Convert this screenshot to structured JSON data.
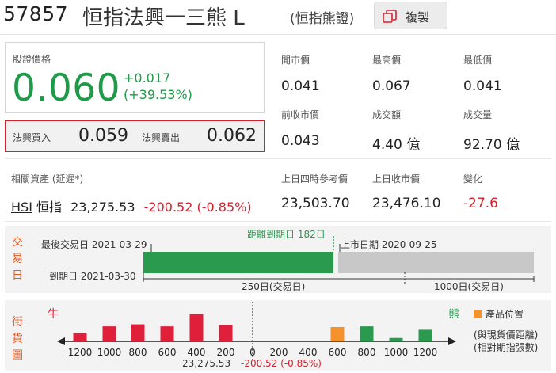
{
  "header": {
    "code": "57857",
    "name": "恒指法興一三熊 L",
    "underlying_tag": "(恒指熊證)",
    "copy_label": "複製"
  },
  "quote": {
    "price_label": "股證價格",
    "price": "0.060",
    "change": "+0.017",
    "change_pct": "(+39.53%)",
    "bid_label": "法興買入",
    "bid": "0.059",
    "ask_label": "法興賣出",
    "ask": "0.062"
  },
  "stats": {
    "open_label": "開市價",
    "open": "0.041",
    "high_label": "最高價",
    "high": "0.067",
    "low_label": "最低價",
    "low": "0.041",
    "prev_close_label": "前收市價",
    "prev_close": "0.043",
    "turnover_label": "成交額",
    "turnover": "4.40 億",
    "volume_label": "成交量",
    "volume": "92.70 億"
  },
  "related": {
    "label": "相關資產 (延遲*)",
    "asset_code": "HSI",
    "asset_name": "恒指",
    "asset_price": "23,275.53",
    "asset_change": "-200.52 (-0.85%)",
    "ref_label": "上日四時參考價",
    "ref_value": "23,503.70",
    "prev_close_label": "上日收市價",
    "prev_close_value": "23,476.10",
    "change_label": "變化",
    "change_value": "-27.6"
  },
  "trading_days": {
    "section_label": [
      "交",
      "易",
      "日"
    ],
    "last_trade_label": "最後交易日 2021-03-29",
    "expiry_label": "到期日 2021-03-30",
    "days_to_expiry_label": "距離到期日 182日",
    "listing_label": "上市日期 2020-09-25",
    "elapsed_days_label": "250日(交易日)",
    "total_days_label": "1000日(交易日)",
    "elapsed_days": 250,
    "total_days": 1000,
    "remaining_days": 182,
    "colors": {
      "elapsed": "#2a9a4f",
      "remaining": "#c8c8c8"
    }
  },
  "street": {
    "section_label": [
      "街",
      "貨",
      "圖"
    ],
    "bull_label": "牛",
    "bear_label": "熊",
    "legend_label": "產品位置",
    "note_line1": "(與現貨價距離)",
    "note_line2": "(相對期指張數)",
    "center_price": "23,275.53",
    "center_change": "-200.52 (-0.85%)",
    "colors": {
      "bull": "#e0203a",
      "bear": "#2a9a4f",
      "product": "#f5922b",
      "bull_label": "#d6202e",
      "bear_label": "#2a9a4f"
    }
  },
  "chart_data": {
    "type": "bar",
    "categories": [
      "1200",
      "1000",
      "800",
      "600",
      "400",
      "200",
      "0",
      "200",
      "400",
      "600",
      "800",
      "1000",
      "1200"
    ],
    "bull_values": [
      12,
      22,
      25,
      22,
      40,
      24,
      null
    ],
    "bear_values": [
      null,
      null,
      null,
      21,
      22,
      5,
      17
    ],
    "product_position_category_index": 9,
    "ylim": [
      0,
      42
    ]
  }
}
